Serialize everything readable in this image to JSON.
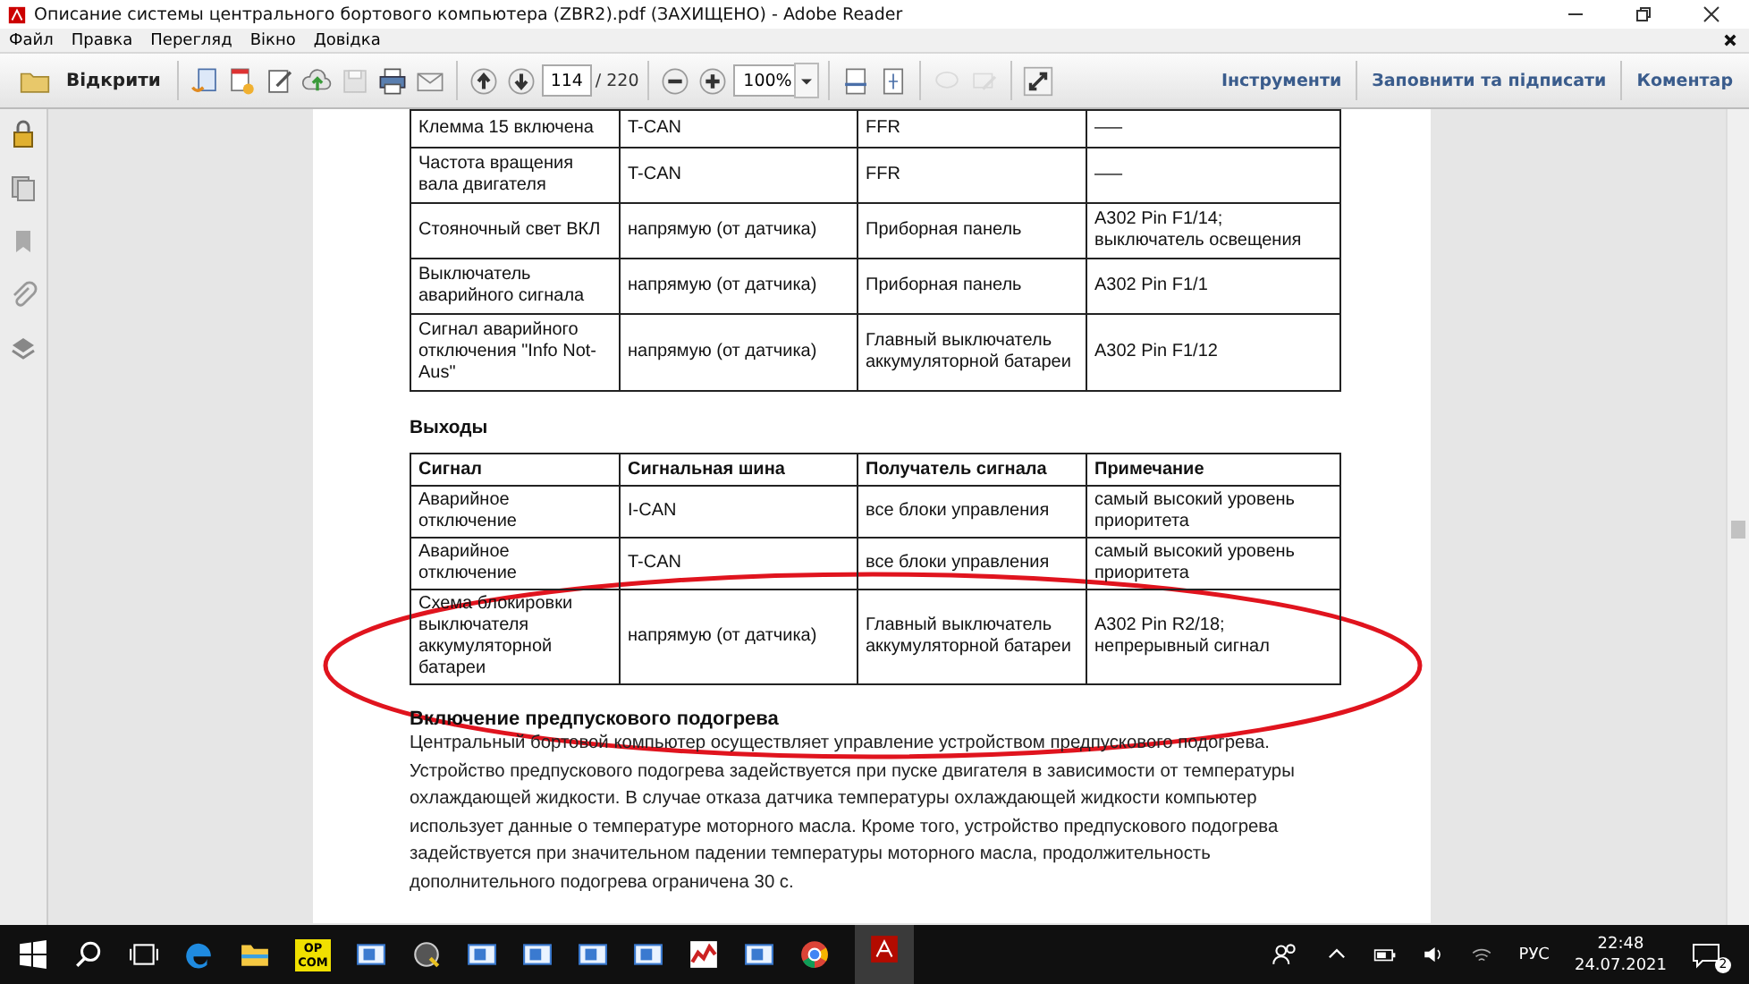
{
  "window": {
    "title": "Описание системы центрального бортового компьютера (ZBR2).pdf (ЗАХИЩЕНО) - Adobe Reader"
  },
  "menu": [
    "Файл",
    "Правка",
    "Перегляд",
    "Вікно",
    "Довідка"
  ],
  "toolbar": {
    "open_label": "Відкрити",
    "page_current": "114",
    "page_total": "/ 220",
    "zoom": "100%",
    "panels": [
      "Інструменти",
      "Заповнити та підписати",
      "Коментар"
    ]
  },
  "inputs_table": {
    "rows": [
      [
        "Клемма 15 включена",
        "T-CAN",
        "FFR",
        "—–"
      ],
      [
        "Частота вращения вала двигателя",
        "T-CAN",
        "FFR",
        "—–"
      ],
      [
        "Стояночный свет ВКЛ",
        "напрямую (от датчика)",
        "Приборная панель",
        "A302  Pin  F1/14; выключатель освещения"
      ],
      [
        "Выключатель аварийного сигнала",
        "напрямую (от датчика)",
        "Приборная панель",
        "A302 Pin F1/1"
      ],
      [
        "Сигнал аварийного отключения \"Info Not-Aus\"",
        "напрямую (от датчика)",
        "Главный выключатель аккумуляторной батареи",
        "A302 Pin F1/12"
      ]
    ]
  },
  "outputs": {
    "heading": "Выходы",
    "columns": [
      "Сигнал",
      "Сигнальная шина",
      "Получатель сигнала",
      "Примечание"
    ],
    "rows": [
      [
        "Аварийное отключение",
        "I-CAN",
        "все блоки управления",
        "самый высокий уровень приоритета"
      ],
      [
        "Аварийное отключение",
        "T-CAN",
        "все блоки управления",
        "самый высокий уровень приоритета"
      ],
      [
        "Схема блокировки выключателя аккумуляторной батареи",
        "напрямую (от датчика)",
        "Главный выключатель аккумуляторной батареи",
        "A302  Pin  R2/18; непрерывный сигнал"
      ]
    ]
  },
  "section": {
    "heading": "Включение предпускового подогрева",
    "text": "Центральный бортовой компьютер осуществляет управление устройством предпускового подогрева.  Устройство предпускового подогрева задействуется при пуске двигателя в зависимости от температуры охлаждающей жидкости.  В случае отказа датчика температуры охлаждающей жидкости компьютер использует данные о температуре моторного масла.  Кроме того, устройство предпускового подогрева задействуется при значительном падении температуры моторного масла, продолжительность дополнительного подогрева ограничена 30 с."
  },
  "taskbar": {
    "app_label": "OP COM",
    "language": "РУС",
    "time": "22:48",
    "date": "24.07.2021",
    "notifications": "2"
  }
}
